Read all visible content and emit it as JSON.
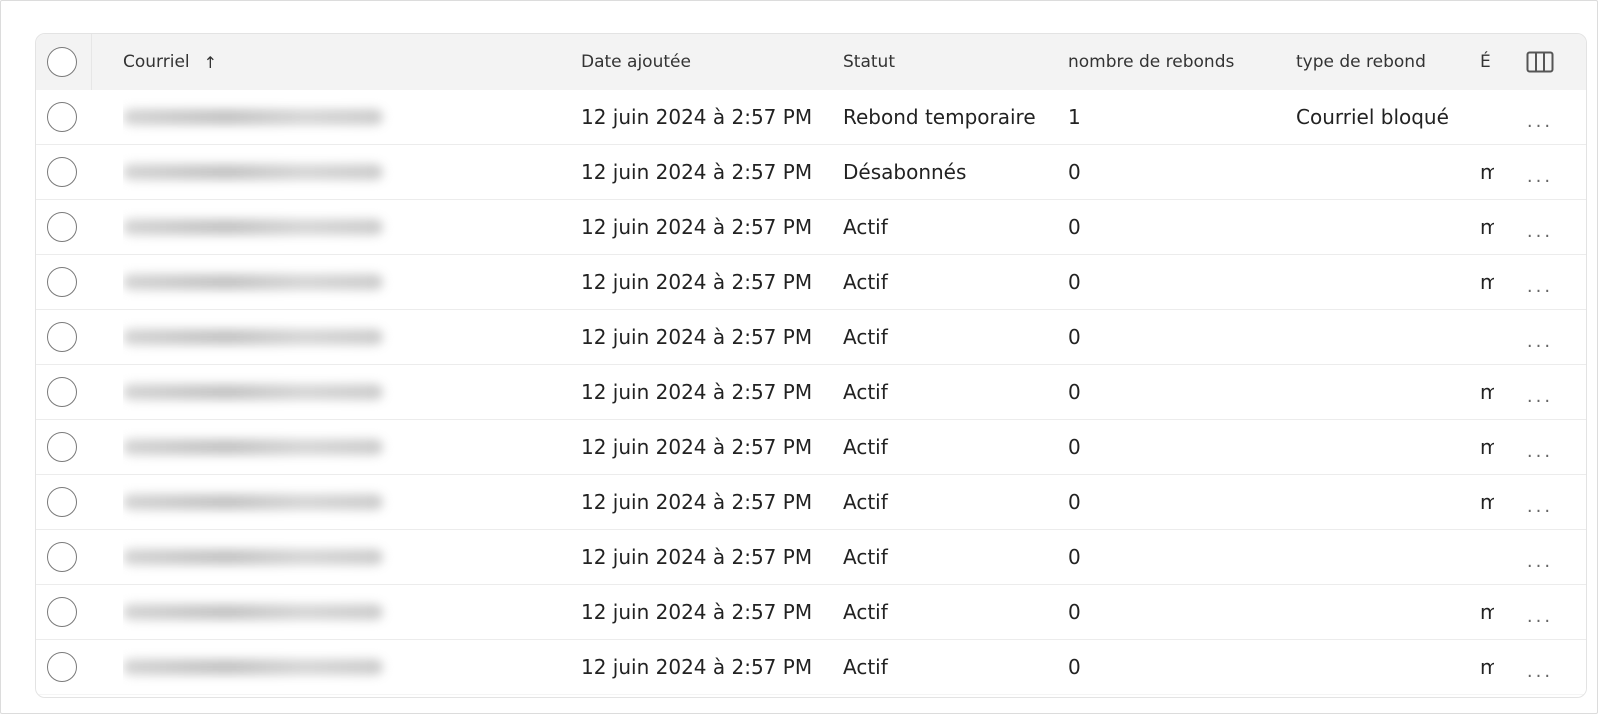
{
  "header": {
    "email_label": "Courriel",
    "date_label": "Date ajoutée",
    "status_label": "Statut",
    "bounce_count_label": "nombre de rebonds",
    "bounce_type_label": "type de rebond",
    "extra_label": "É",
    "sort_icon": "↑",
    "columns_icon": "columns-icon"
  },
  "rows": [
    {
      "date": "12 juin 2024 à 2:57 PM",
      "status": "Rebond temporaire",
      "count": "1",
      "type": "Courriel bloqué",
      "extra": ""
    },
    {
      "date": "12 juin 2024 à 2:57 PM",
      "status": "Désabonnés",
      "count": "0",
      "type": "",
      "extra": "m"
    },
    {
      "date": "12 juin 2024 à 2:57 PM",
      "status": "Actif",
      "count": "0",
      "type": "",
      "extra": "m"
    },
    {
      "date": "12 juin 2024 à 2:57 PM",
      "status": "Actif",
      "count": "0",
      "type": "",
      "extra": "m"
    },
    {
      "date": "12 juin 2024 à 2:57 PM",
      "status": "Actif",
      "count": "0",
      "type": "",
      "extra": ""
    },
    {
      "date": "12 juin 2024 à 2:57 PM",
      "status": "Actif",
      "count": "0",
      "type": "",
      "extra": "m"
    },
    {
      "date": "12 juin 2024 à 2:57 PM",
      "status": "Actif",
      "count": "0",
      "type": "",
      "extra": "m"
    },
    {
      "date": "12 juin 2024 à 2:57 PM",
      "status": "Actif",
      "count": "0",
      "type": "",
      "extra": "m"
    },
    {
      "date": "12 juin 2024 à 2:57 PM",
      "status": "Actif",
      "count": "0",
      "type": "",
      "extra": ""
    },
    {
      "date": "12 juin 2024 à 2:57 PM",
      "status": "Actif",
      "count": "0",
      "type": "",
      "extra": "m"
    },
    {
      "date": "12 juin 2024 à 2:57 PM",
      "status": "Actif",
      "count": "0",
      "type": "",
      "extra": "m"
    }
  ],
  "actions_label": "...",
  "colors": {
    "header_bg": "#f3f3f3",
    "border": "#ececec",
    "text": "#222222"
  }
}
